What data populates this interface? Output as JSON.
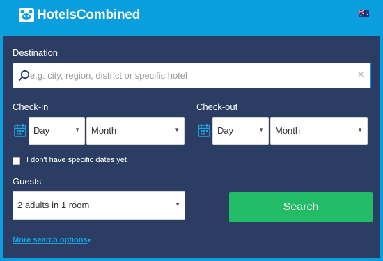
{
  "brand": {
    "name": "HotelsCombined",
    "icon": "bear-logo-icon",
    "language_flag": "australia-flag-icon"
  },
  "colors": {
    "header": "#0a9ede",
    "panel": "#2b3d62",
    "search_button": "#22bb66",
    "link": "#15a4e8"
  },
  "destination": {
    "label": "Destination",
    "placeholder": "e.g. city, region, district or specific hotel",
    "value": "",
    "search_icon": "magnifier-icon",
    "clear_glyph": "×"
  },
  "checkin": {
    "label": "Check-in",
    "icon": "calendar-icon",
    "day": "Day",
    "month": "Month"
  },
  "checkout": {
    "label": "Check-out",
    "icon": "calendar-icon",
    "day": "Day",
    "month": "Month"
  },
  "no_dates": {
    "label": "I don't have specific dates yet",
    "checked": false
  },
  "guests": {
    "label": "Guests",
    "value": "2 adults in 1 room"
  },
  "search_button": "Search",
  "more_options": "More search options"
}
